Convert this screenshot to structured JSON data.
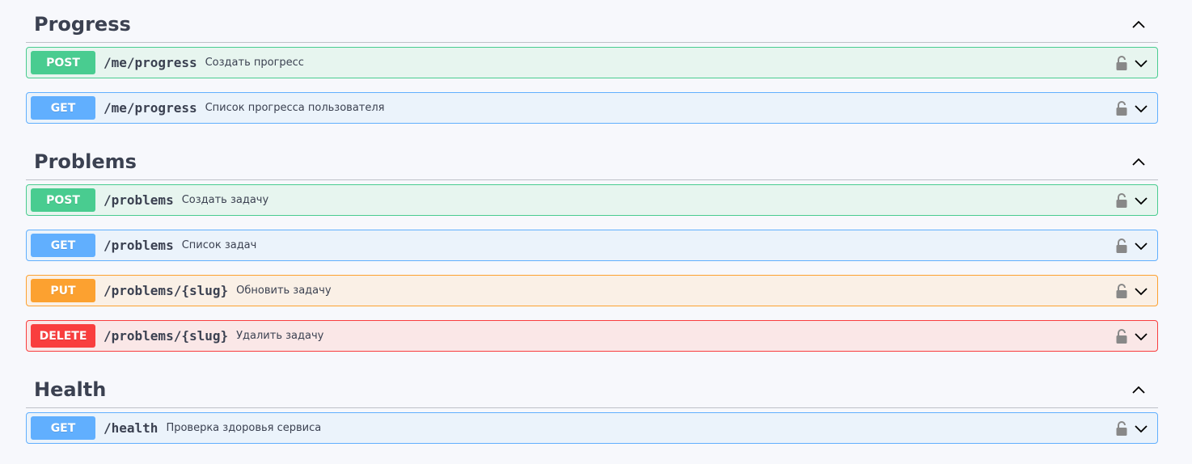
{
  "sections": [
    {
      "title": "Progress",
      "toggle_icon": "chevron-up-icon",
      "operations": [
        {
          "method": "POST",
          "path": "/me/progress",
          "summary": "Создать прогресс"
        },
        {
          "method": "GET",
          "path": "/me/progress",
          "summary": "Список прогресса пользователя"
        }
      ]
    },
    {
      "title": "Problems",
      "toggle_icon": "chevron-up-icon",
      "operations": [
        {
          "method": "POST",
          "path": "/problems",
          "summary": "Создать задачу"
        },
        {
          "method": "GET",
          "path": "/problems",
          "summary": "Список задач"
        },
        {
          "method": "PUT",
          "path": "/problems/{slug}",
          "summary": "Обновить задачу"
        },
        {
          "method": "DELETE",
          "path": "/problems/{slug}",
          "summary": "Удалить задачу"
        }
      ]
    },
    {
      "title": "Health",
      "toggle_icon": "chevron-up-icon",
      "operations": [
        {
          "method": "GET",
          "path": "/health",
          "summary": "Проверка здоровья сервиса"
        }
      ]
    }
  ],
  "colors": {
    "post": "#49cc90",
    "get": "#61affe",
    "put": "#fca130",
    "delete": "#f93e3e",
    "text": "#3b4151"
  },
  "icons": {
    "lock": "lock-icon",
    "expand": "chevron-down-icon"
  }
}
